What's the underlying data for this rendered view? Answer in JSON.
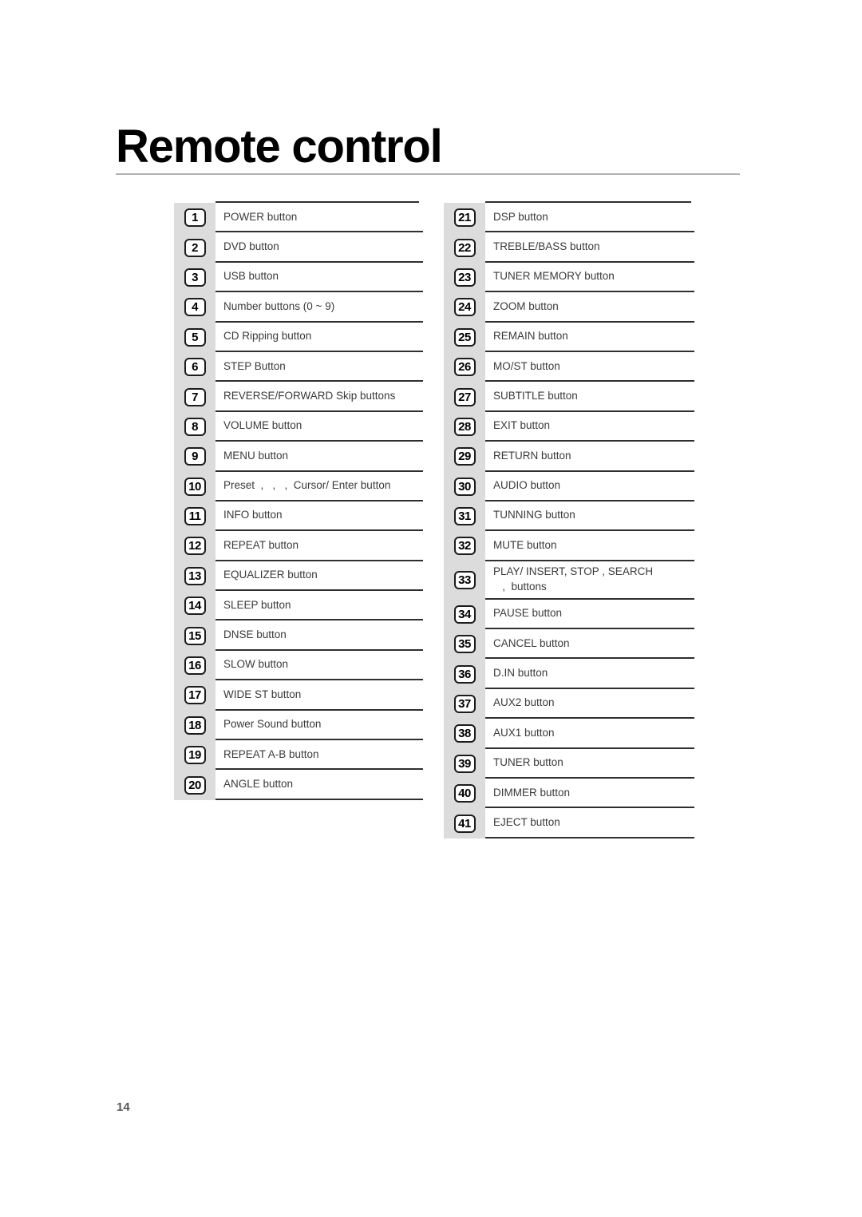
{
  "document": {
    "title": "Remote control",
    "page_number": "14"
  },
  "columns": [
    {
      "name": "left-column",
      "items": [
        {
          "number": "1",
          "lines": [
            "POWER button"
          ]
        },
        {
          "number": "2",
          "lines": [
            "DVD button"
          ]
        },
        {
          "number": "3",
          "lines": [
            "USB button"
          ]
        },
        {
          "number": "4",
          "lines": [
            "Number buttons (0 ~ 9)"
          ]
        },
        {
          "number": "5",
          "lines": [
            "CD Ripping button"
          ]
        },
        {
          "number": "6",
          "lines": [
            "STEP Button"
          ]
        },
        {
          "number": "7",
          "lines": [
            "REVERSE/FORWARD Skip buttons"
          ]
        },
        {
          "number": "8",
          "lines": [
            "VOLUME button"
          ]
        },
        {
          "number": "9",
          "lines": [
            "MENU button"
          ]
        },
        {
          "number": "10",
          "lines": [
            "Preset  ,   ,   ,  Cursor/ Enter button"
          ]
        },
        {
          "number": "11",
          "lines": [
            "INFO button"
          ]
        },
        {
          "number": "12",
          "lines": [
            "REPEAT button"
          ]
        },
        {
          "number": "13",
          "lines": [
            "EQUALIZER button"
          ]
        },
        {
          "number": "14",
          "lines": [
            "SLEEP button"
          ]
        },
        {
          "number": "15",
          "lines": [
            "DNSE button"
          ]
        },
        {
          "number": "16",
          "lines": [
            "SLOW button"
          ]
        },
        {
          "number": "17",
          "lines": [
            "WIDE ST button"
          ]
        },
        {
          "number": "18",
          "lines": [
            "Power Sound button"
          ]
        },
        {
          "number": "19",
          "lines": [
            "REPEAT A-B button"
          ]
        },
        {
          "number": "20",
          "lines": [
            "ANGLE button"
          ]
        }
      ]
    },
    {
      "name": "right-column",
      "items": [
        {
          "number": "21",
          "lines": [
            "DSP button"
          ]
        },
        {
          "number": "22",
          "lines": [
            "TREBLE/BASS button"
          ]
        },
        {
          "number": "23",
          "lines": [
            "TUNER MEMORY button"
          ]
        },
        {
          "number": "24",
          "lines": [
            "ZOOM button"
          ]
        },
        {
          "number": "25",
          "lines": [
            "REMAIN button"
          ]
        },
        {
          "number": "26",
          "lines": [
            "MO/ST button"
          ]
        },
        {
          "number": "27",
          "lines": [
            "SUBTITLE button"
          ]
        },
        {
          "number": "28",
          "lines": [
            "EXIT button"
          ]
        },
        {
          "number": "29",
          "lines": [
            "RETURN button"
          ]
        },
        {
          "number": "30",
          "lines": [
            "AUDIO button"
          ]
        },
        {
          "number": "31",
          "lines": [
            "TUNNING button"
          ]
        },
        {
          "number": "32",
          "lines": [
            "MUTE button"
          ]
        },
        {
          "number": "33",
          "lines": [
            "PLAY/ INSERT, STOP , SEARCH",
            "   ,  buttons"
          ]
        },
        {
          "number": "34",
          "lines": [
            "PAUSE button"
          ]
        },
        {
          "number": "35",
          "lines": [
            "CANCEL button"
          ]
        },
        {
          "number": "36",
          "lines": [
            "D.IN button"
          ]
        },
        {
          "number": "37",
          "lines": [
            "AUX2 button"
          ]
        },
        {
          "number": "38",
          "lines": [
            "AUX1 button"
          ]
        },
        {
          "number": "39",
          "lines": [
            "TUNER button"
          ]
        },
        {
          "number": "40",
          "lines": [
            "DIMMER button"
          ]
        },
        {
          "number": "41",
          "lines": [
            "EJECT button"
          ]
        }
      ]
    }
  ],
  "colors": {
    "band_gray": "#dcdcdc",
    "rule_dark": "#2f2f2f",
    "title_rule": "#b4b4b4",
    "text": "#3a3a3a",
    "badge_border": "#1c1c1c"
  }
}
